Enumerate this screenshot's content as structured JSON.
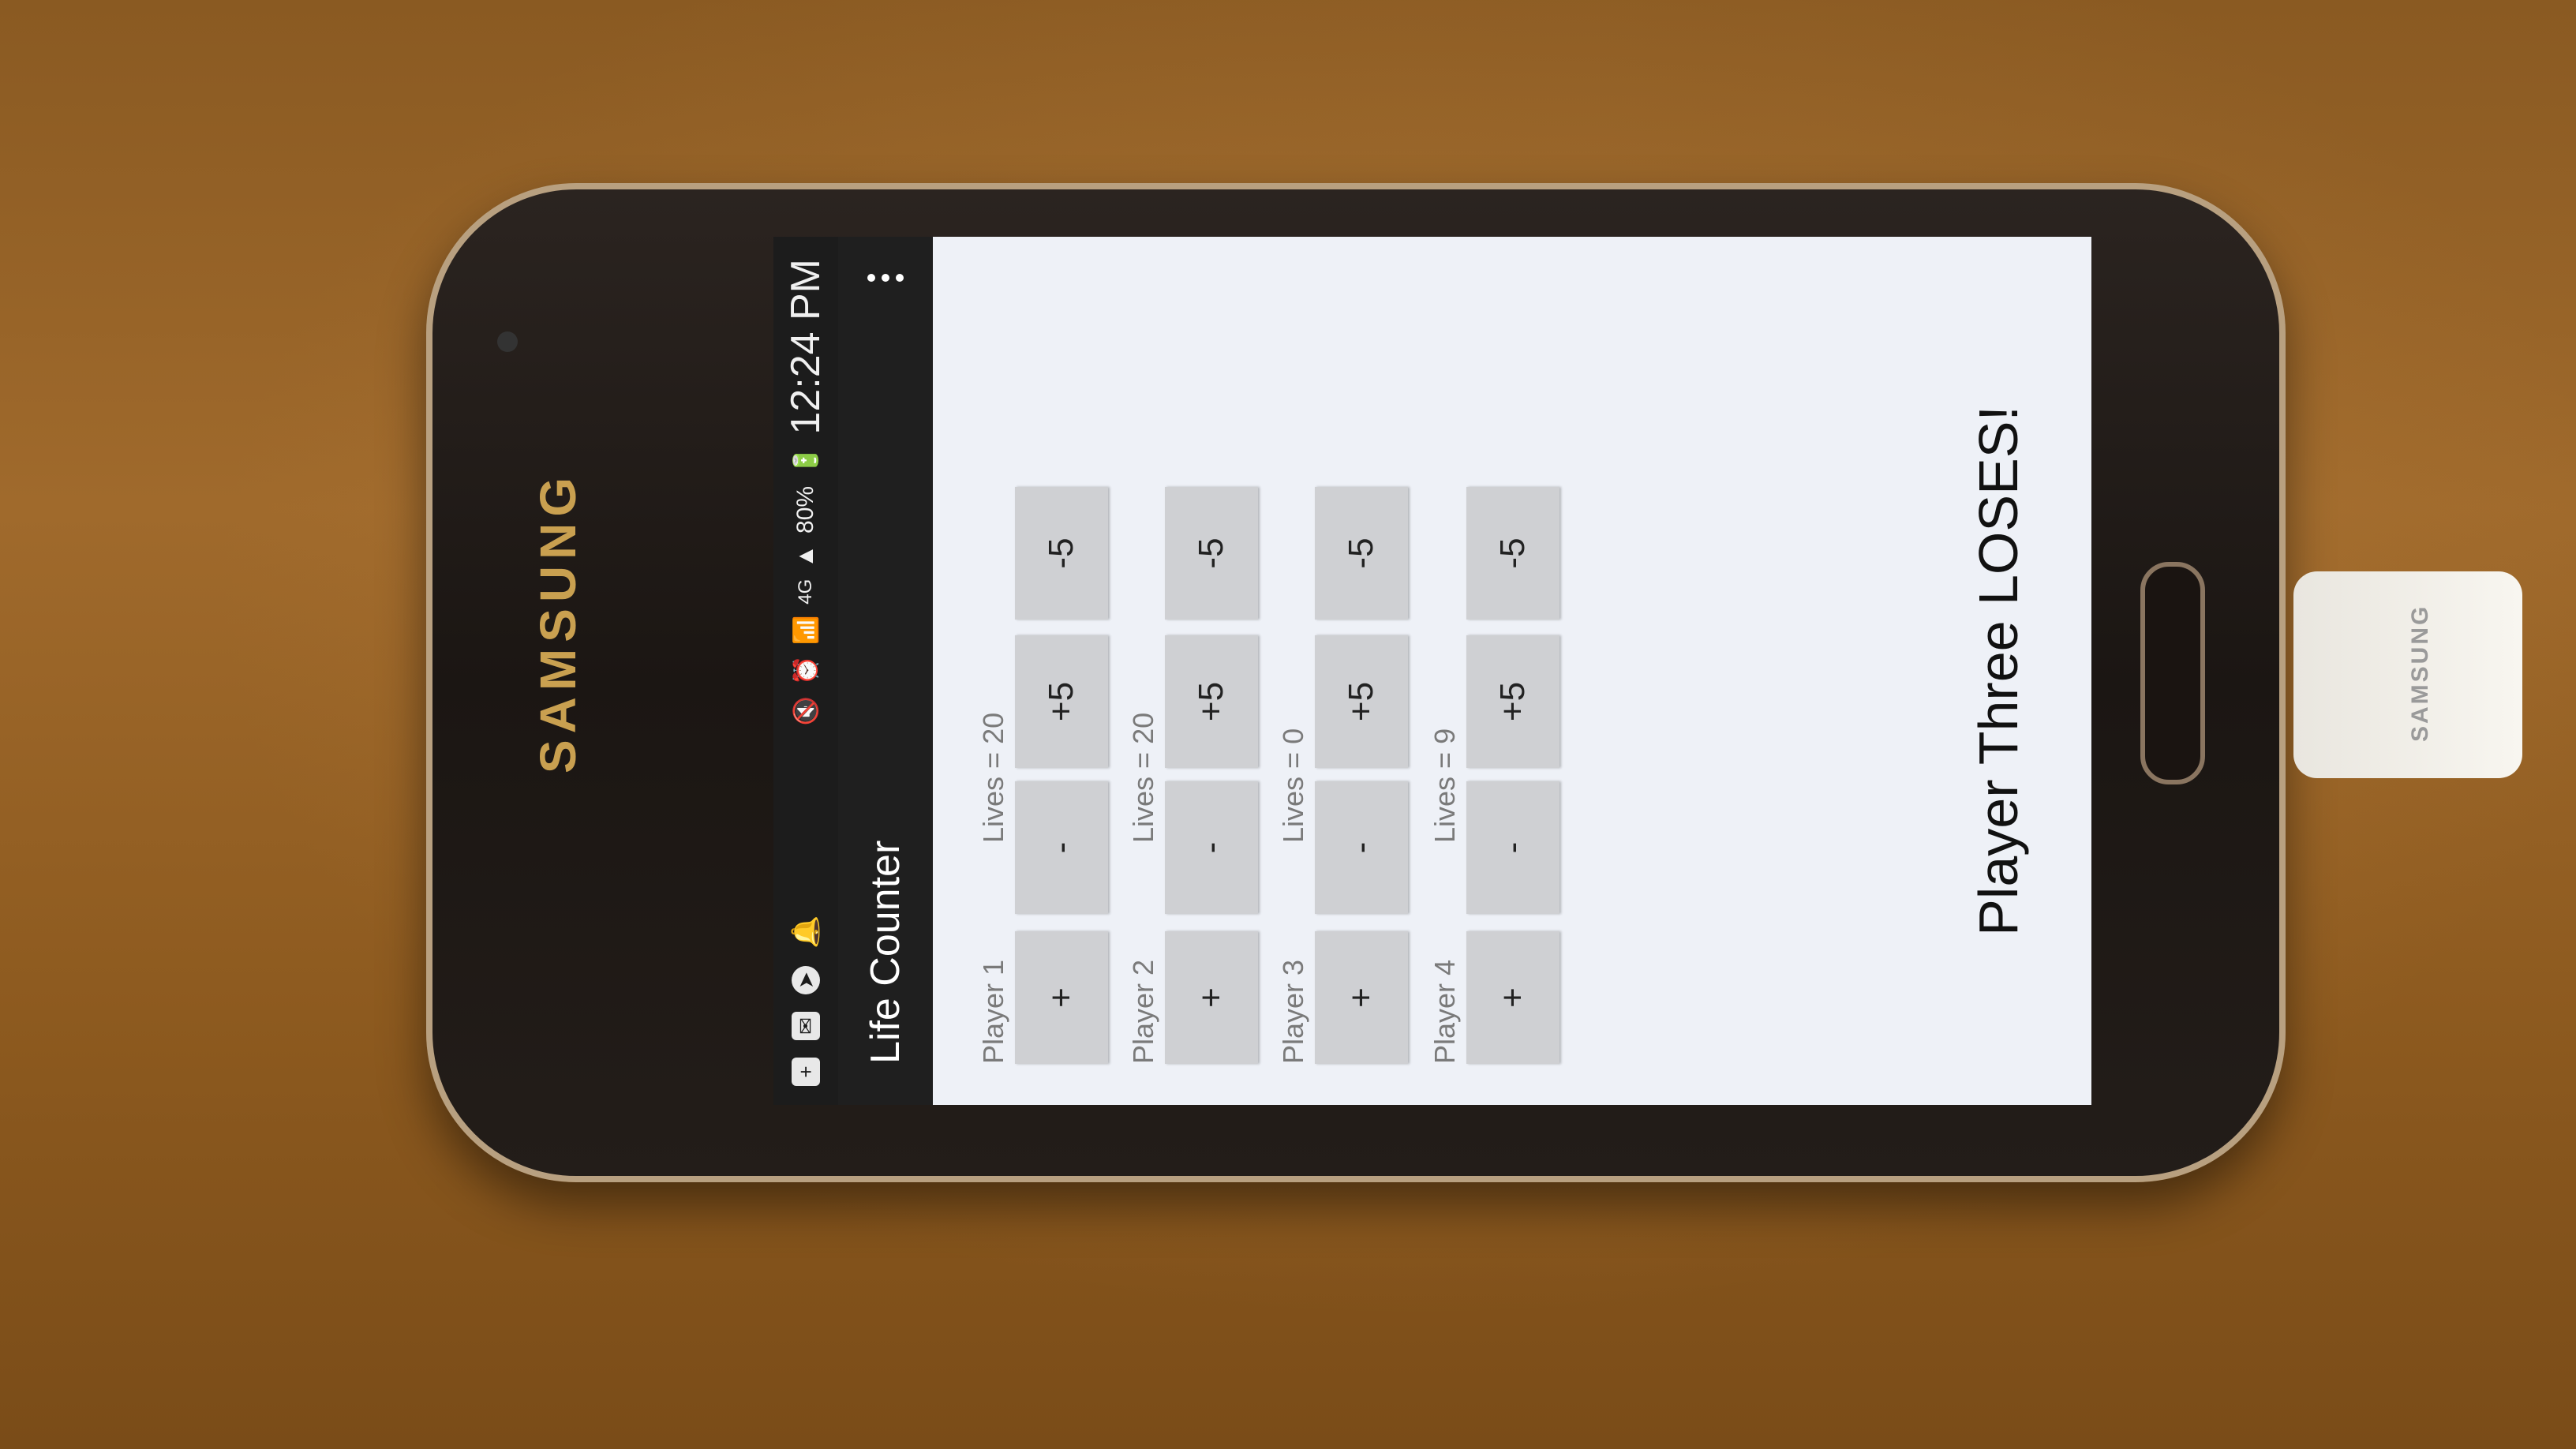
{
  "phone": {
    "brand": "SAMSUNG",
    "charger_brand": "SAMSUNG"
  },
  "status_bar": {
    "icons": [
      "plus-box-icon",
      "mail-icon",
      "messenger-icon",
      "notification-bell-icon"
    ],
    "right_icons": [
      "mute-icon",
      "alarm-icon",
      "wifi-icon",
      "4g-icon",
      "signal-icon"
    ],
    "network": "4G",
    "battery": "80%",
    "time": "12:24 PM"
  },
  "toolbar": {
    "title": "Life Counter",
    "menu_icon": "overflow-menu-icon"
  },
  "players": [
    {
      "name": "Player 1",
      "lives": "Lives = 20"
    },
    {
      "name": "Player 2",
      "lives": "Lives = 20"
    },
    {
      "name": "Player 3",
      "lives": "Lives = 0"
    },
    {
      "name": "Player 4",
      "lives": "Lives = 9"
    }
  ],
  "buttons": {
    "plus": "+",
    "minus": "-",
    "plus_five": "+5",
    "minus_five": "-5"
  },
  "result_message": "Player Three LOSES!"
}
